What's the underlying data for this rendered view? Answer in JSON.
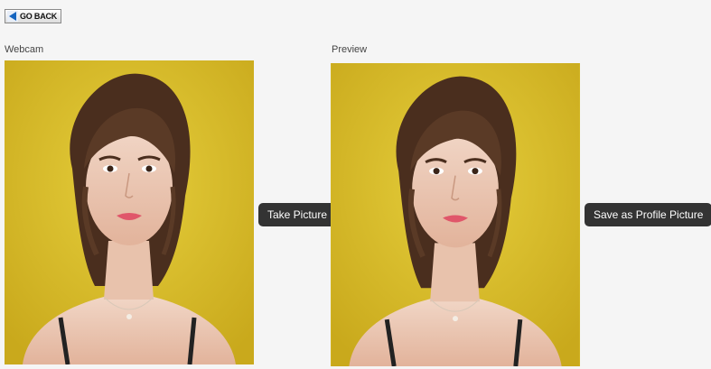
{
  "header": {
    "go_back_label": "GO BACK",
    "go_back_icon": "arrow-left-icon"
  },
  "webcam": {
    "label": "Webcam"
  },
  "preview": {
    "label": "Preview"
  },
  "actions": {
    "take_picture_label": "Take Picture",
    "save_profile_label": "Save as Profile Picture"
  },
  "colors": {
    "background": "#f5f5f5",
    "photo_background": "#d9bf2a",
    "button_dark": "#333333",
    "go_back_arrow": "#1565c0"
  }
}
